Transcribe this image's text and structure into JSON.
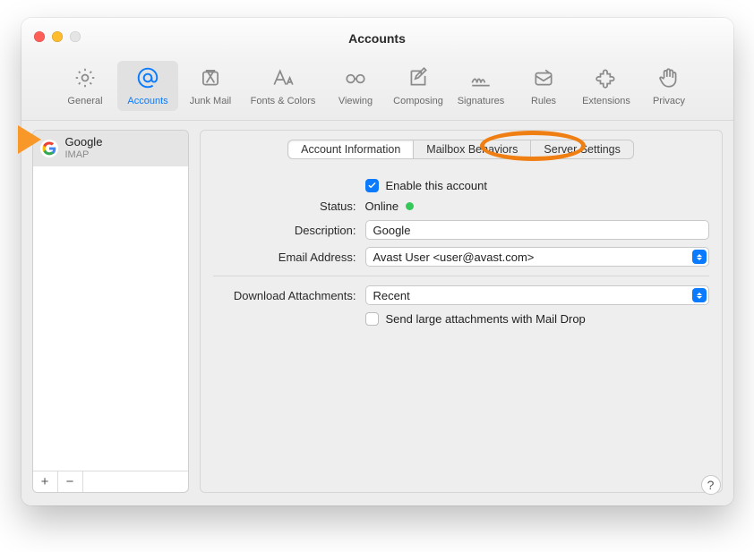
{
  "title": "Accounts",
  "toolbar": [
    {
      "label": "General"
    },
    {
      "label": "Accounts"
    },
    {
      "label": "Junk Mail"
    },
    {
      "label": "Fonts & Colors"
    },
    {
      "label": "Viewing"
    },
    {
      "label": "Composing"
    },
    {
      "label": "Signatures"
    },
    {
      "label": "Rules"
    },
    {
      "label": "Extensions"
    },
    {
      "label": "Privacy"
    }
  ],
  "sidebar": {
    "accounts": [
      {
        "name": "Google",
        "type": "IMAP"
      }
    ],
    "add": "+",
    "remove": "−"
  },
  "tabs": {
    "info": "Account Information",
    "mailbox": "Mailbox Behaviors",
    "server": "Server Settings"
  },
  "form": {
    "enable_label": "Enable this account",
    "enable_checked": true,
    "status_label": "Status:",
    "status_value": "Online",
    "description_label": "Description:",
    "description_value": "Google",
    "email_label": "Email Address:",
    "email_value": "Avast User <user@avast.com>",
    "download_label": "Download Attachments:",
    "download_value": "Recent",
    "maildrop_label": "Send large attachments with Mail Drop",
    "maildrop_checked": false
  },
  "help": "?"
}
